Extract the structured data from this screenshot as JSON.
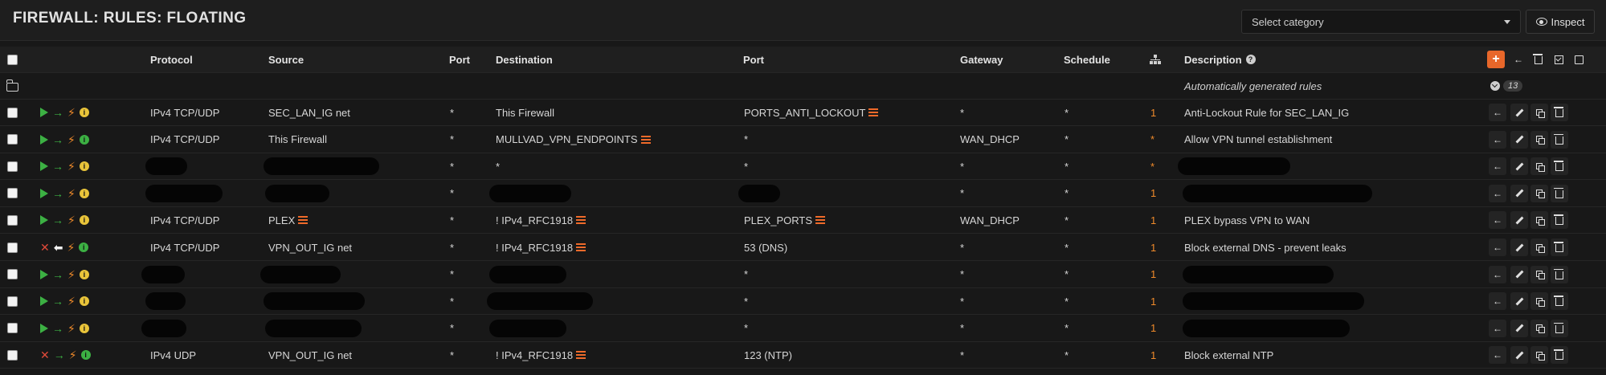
{
  "page": {
    "title": "FIREWALL: RULES: FLOATING"
  },
  "category_select": {
    "value": "Select category"
  },
  "inspect_label": "Inspect",
  "headers": {
    "protocol": "Protocol",
    "source": "Source",
    "port": "Port",
    "destination": "Destination",
    "dest_port": "Port",
    "gateway": "Gateway",
    "schedule": "Schedule",
    "description": "Description"
  },
  "auto_group": {
    "label": "Automatically generated rules",
    "count": "13"
  },
  "icons": {
    "play": "play-icon",
    "block": "x-icon",
    "direction": "arrow-right-icon",
    "direction_in": "arrow-left-icon",
    "quick": "lightning-bolt-icon",
    "info": "info-circle-icon",
    "alias": "list-icon",
    "move": "arrow-left-icon",
    "edit": "pencil-icon",
    "clone": "copy-icon",
    "delete": "trash-icon"
  },
  "colors": {
    "accent": "#e8672a",
    "pass": "#3cb043",
    "block": "#e04a3a",
    "bolt": "#ef8a2a",
    "info_yellow": "#e9c43a"
  },
  "rules": [
    {
      "action": "pass",
      "dir": "out",
      "info": "yellow",
      "protocol": "IPv4 TCP/UDP",
      "source": "SEC_LAN_IG net",
      "source_alias": false,
      "port": "*",
      "destination": "This Firewall",
      "dest_alias": false,
      "dest_port": "PORTS_ANTI_LOCKOUT",
      "dest_port_alias": true,
      "gateway": "*",
      "schedule": "*",
      "count": "1",
      "description": "Anti-Lockout Rule for SEC_LAN_IG"
    },
    {
      "action": "pass",
      "dir": "out",
      "info": "green",
      "protocol": "IPv4 TCP/UDP",
      "source": "This Firewall",
      "source_alias": false,
      "port": "*",
      "destination": "MULLVAD_VPN_ENDPOINTS",
      "dest_alias": true,
      "dest_port": "*",
      "dest_port_alias": false,
      "gateway": "WAN_DHCP",
      "schedule": "*",
      "count": "*",
      "description": "Allow VPN tunnel establishment"
    },
    {
      "action": "pass",
      "dir": "out",
      "info": "yellow",
      "protocol": "",
      "source": "",
      "source_alias": false,
      "port": "*",
      "destination": "*",
      "dest_alias": false,
      "dest_port": "*",
      "dest_port_alias": false,
      "gateway": "*",
      "schedule": "*",
      "count": "*",
      "description": ""
    },
    {
      "action": "pass",
      "dir": "out",
      "info": "yellow",
      "protocol": "",
      "source": "",
      "source_alias": false,
      "port": "*",
      "destination": "",
      "dest_alias": false,
      "dest_port": "",
      "dest_port_alias": false,
      "gateway": "*",
      "schedule": "*",
      "count": "1",
      "description": ""
    },
    {
      "action": "pass",
      "dir": "out",
      "info": "yellow",
      "protocol": "IPv4 TCP/UDP",
      "source": "PLEX",
      "source_alias": true,
      "port": "*",
      "destination": "! IPv4_RFC1918",
      "dest_alias": true,
      "dest_port": "PLEX_PORTS",
      "dest_port_alias": true,
      "gateway": "WAN_DHCP",
      "schedule": "*",
      "count": "1",
      "description": "PLEX bypass VPN to WAN"
    },
    {
      "action": "block",
      "dir": "in",
      "info": "green",
      "protocol": "IPv4 TCP/UDP",
      "source": "VPN_OUT_IG net",
      "source_alias": false,
      "port": "*",
      "destination": "! IPv4_RFC1918",
      "dest_alias": true,
      "dest_port": "53 (DNS)",
      "dest_port_alias": false,
      "gateway": "*",
      "schedule": "*",
      "count": "1",
      "description": "Block external DNS - prevent leaks"
    },
    {
      "action": "pass",
      "dir": "out",
      "info": "yellow",
      "protocol": "",
      "source": "",
      "source_alias": false,
      "port": "*",
      "destination": "",
      "dest_alias": false,
      "dest_port": "*",
      "dest_port_alias": false,
      "gateway": "*",
      "schedule": "*",
      "count": "1",
      "description": ""
    },
    {
      "action": "pass",
      "dir": "out",
      "info": "yellow",
      "protocol": "",
      "source": "",
      "source_alias": false,
      "port": "*",
      "destination": "",
      "dest_alias": false,
      "dest_port": "*",
      "dest_port_alias": false,
      "gateway": "*",
      "schedule": "*",
      "count": "1",
      "description": ""
    },
    {
      "action": "pass",
      "dir": "out",
      "info": "yellow",
      "protocol": "",
      "source": "",
      "source_alias": false,
      "port": "*",
      "destination": "",
      "dest_alias": false,
      "dest_port": "*",
      "dest_port_alias": false,
      "gateway": "*",
      "schedule": "*",
      "count": "1",
      "description": ""
    },
    {
      "action": "block",
      "dir": "out",
      "info": "green",
      "protocol": "IPv4 UDP",
      "source": "VPN_OUT_IG net",
      "source_alias": false,
      "port": "*",
      "destination": "! IPv4_RFC1918",
      "dest_alias": true,
      "dest_port": "123 (NTP)",
      "dest_port_alias": false,
      "gateway": "*",
      "schedule": "*",
      "count": "1",
      "description": "Block external NTP"
    }
  ]
}
